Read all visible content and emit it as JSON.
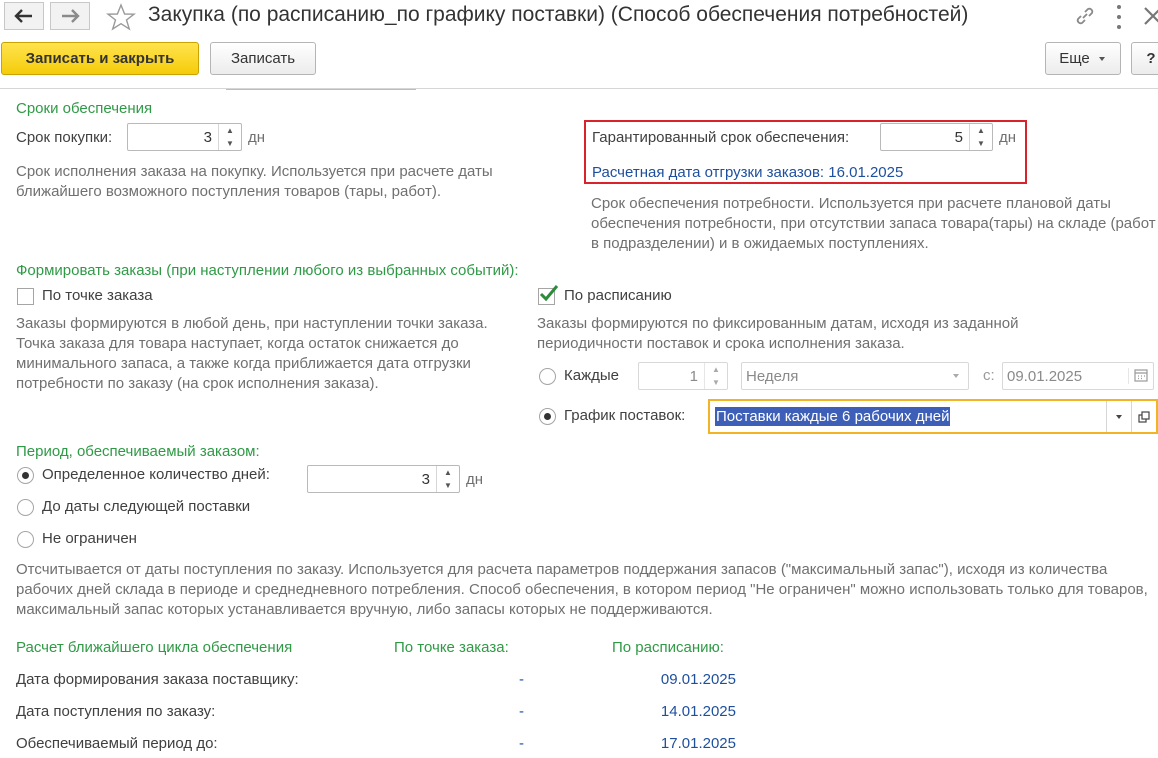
{
  "window": {
    "title": "Закупка (по расписанию_по графику поставки) (Способ обеспечения потребностей)"
  },
  "toolbar": {
    "save_close_label": "Записать и закрыть",
    "save_label": "Записать",
    "more_label": "Еще",
    "help_label": "?"
  },
  "terms": {
    "heading": "Сроки обеспечения",
    "purchase_label": "Срок покупки:",
    "purchase_value": "3",
    "purchase_unit": "дн",
    "purchase_hint": "Срок исполнения заказа на покупку. Используется при расчете даты ближайшего возможного поступления товаров (тары, работ).",
    "guaranteed_label": "Гарантированный срок обеспечения:",
    "guaranteed_value": "5",
    "guaranteed_unit": "дн",
    "calc_date_text": "Расчетная дата отгрузки заказов: 16.01.2025",
    "guaranteed_hint": "Срок обеспечения потребности. Используется при расчете плановой даты обеспечения потребности, при отсутствии запаса товара(тары) на складе (работ в подразделении) и в ожидаемых поступлениях."
  },
  "orders": {
    "heading": "Формировать заказы (при наступлении любого из выбранных событий):",
    "order_point_label": "По точке заказа",
    "order_point_checked": false,
    "order_point_hint": "Заказы формируются в любой день, при наступлении точки заказа. Точка заказа для товара  наступает, когда остаток снижается до минимального запаса, а также когда приближается дата отгрузки потребности по заказу (на срок исполнения заказа).",
    "schedule_label": "По расписанию",
    "schedule_checked": true,
    "schedule_hint": "Заказы формируются по фиксированным датам, исходя из заданной периодичности поставок и срока исполнения заказа.",
    "every_label": "Каждые",
    "every_value": "1",
    "every_period": "Неделя",
    "from_label": "с:",
    "from_date": "09.01.2025",
    "delivery_schedule_label": "График поставок:",
    "delivery_schedule_value": "Поставки каждые 6 рабочих дней"
  },
  "period": {
    "heading": "Период, обеспечиваемый заказом:",
    "opt_days_label": "Определенное количество дней:",
    "days_value": "3",
    "days_unit": "дн",
    "opt_next_label": "До даты следующей поставки",
    "opt_unlimited_label": "Не ограничен",
    "hint": "Отсчитывается от даты поступления по заказу. Используется для расчета параметров поддержания запасов (\"максимальный запас\"), исходя из количества рабочих дней склада в периоде и среднедневного потребления. Способ обеспечения, в котором период \"Не ограничен\" можно использовать только для товаров, максимальный запас которых устанавливается вручную, либо запасы которых не поддерживаются."
  },
  "cycle": {
    "heading": "Расчет ближайшего цикла обеспечения",
    "col_point": "По точке заказа:",
    "col_schedule": "По расписанию:",
    "rows": [
      {
        "label": "Дата формирования заказа поставщику:",
        "point": "-",
        "schedule": "09.01.2025"
      },
      {
        "label": "Дата поступления по заказу:",
        "point": "-",
        "schedule": "14.01.2025"
      },
      {
        "label": "Обеспечиваемый период до:",
        "point": "-",
        "schedule": "17.01.2025"
      }
    ]
  },
  "colors": {
    "accent_green": "#2f9a46",
    "link_blue": "#1e4f9e",
    "highlight_red": "#d9232a",
    "focus_orange": "#f2b424",
    "primary_yellow": "#f5cc0a",
    "selection_blue": "#3d5fb8"
  }
}
